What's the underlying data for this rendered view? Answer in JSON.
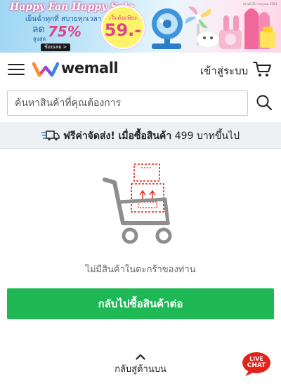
{
  "banner": {
    "headline": "Happy Fan Happy Sale",
    "subline": "เย็นฉ่ำทุกที่ สบายทุกเวลา",
    "discount_prefix": "ลด",
    "discount_value": "75%",
    "discount_sub": "สูงสุด",
    "shop_button": "ช้อปเลย >",
    "price_label": "เริ่มต้นเพียง",
    "price_value": "59.-",
    "note": "ถึงวันที่ 31 กรกฎาคม 2564"
  },
  "header": {
    "logo_text": "wemall",
    "login_label": "เข้าสู่ระบบ",
    "menu_icon": "hamburger-menu-icon",
    "cart_icon": "shopping-cart-icon"
  },
  "search": {
    "placeholder": "ค้นหาสินค้าที่คุณต้องการ",
    "value": "",
    "icon": "search-icon"
  },
  "shipping": {
    "bold": "ฟรีค่าจัดส่ง! เมื่อซื้อสินค้า",
    "amount": "499",
    "suffix": "บาทขึ้นไป",
    "icon": "fast-delivery-truck-icon"
  },
  "empty_cart": {
    "message": "ไม่มีสินค้าในตะกร้าของท่าน",
    "button_label": "กลับไปซื้อสินค้าต่อ",
    "illustration": "empty-cart-illustration"
  },
  "footer": {
    "back_to_top": "กลับสู่ด้านบน",
    "chat_line1": "LIVE",
    "chat_line2": "CHAT"
  },
  "colors": {
    "primary_green": "#1eb854",
    "chat_red": "#e2231a",
    "brand_blue": "#1c5fa8",
    "brand_pink": "#e0458a",
    "strip_bg": "#eef1f4"
  }
}
